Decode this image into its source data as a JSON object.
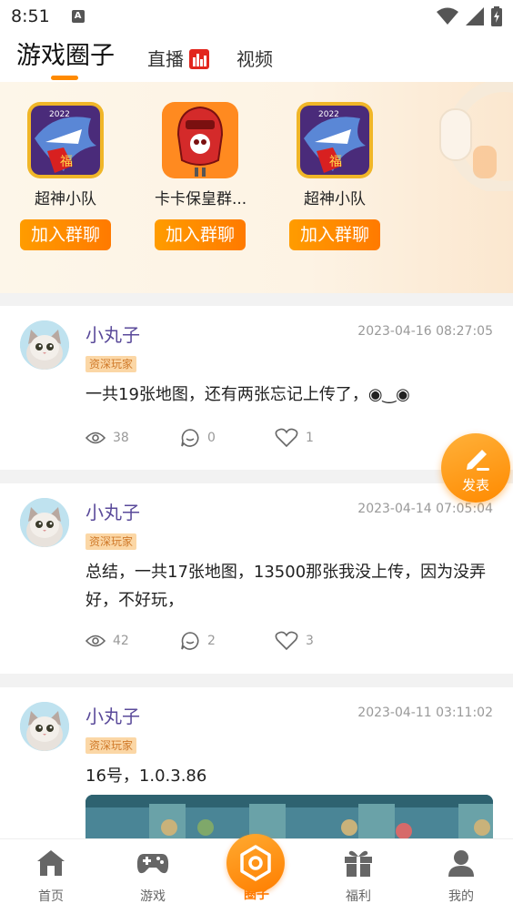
{
  "status": {
    "time": "8:51",
    "indicator": "A"
  },
  "header": {
    "tabs": [
      {
        "label": "游戏圈子",
        "active": true
      },
      {
        "label": "直播",
        "active": false
      },
      {
        "label": "视频",
        "active": false
      }
    ]
  },
  "groups": [
    {
      "name": "超神小队",
      "icon": "dragon-game-icon",
      "join_label": "加入群聊"
    },
    {
      "name": "卡卡保皇群...",
      "icon": "red-robot-icon",
      "join_label": "加入群聊"
    },
    {
      "name": "超神小队",
      "icon": "dragon-game-icon",
      "join_label": "加入群聊"
    }
  ],
  "posts": [
    {
      "username": "小丸子",
      "time": "2023-04-16 08:27:05",
      "badge": "资深玩家",
      "content": "一共19张地图，还有两张忘记上传了，◉‿◉",
      "views": "38",
      "comments": "0",
      "likes": "1"
    },
    {
      "username": "小丸子",
      "time": "2023-04-14 07:05:04",
      "badge": "资深玩家",
      "content": "总结，一共17张地图，13500那张我没上传，因为没弄好，不好玩，",
      "views": "42",
      "comments": "2",
      "likes": "3"
    },
    {
      "username": "小丸子",
      "time": "2023-04-11 03:11:02",
      "badge": "资深玩家",
      "content": "16号，1.0.3.86"
    }
  ],
  "fab": {
    "label": "发表",
    "icon": "edit-icon"
  },
  "nav": [
    {
      "label": "首页",
      "icon": "home-icon",
      "active": false
    },
    {
      "label": "游戏",
      "icon": "gamepad-icon",
      "active": false
    },
    {
      "label": "圈子",
      "icon": "hexagon-icon",
      "active": true
    },
    {
      "label": "福利",
      "icon": "gift-icon",
      "active": false
    },
    {
      "label": "我的",
      "icon": "user-icon",
      "active": false
    }
  ],
  "colors": {
    "accent": "#ff7a00",
    "username": "#5a4a9a",
    "badge_bg": "#fbd7a6"
  }
}
